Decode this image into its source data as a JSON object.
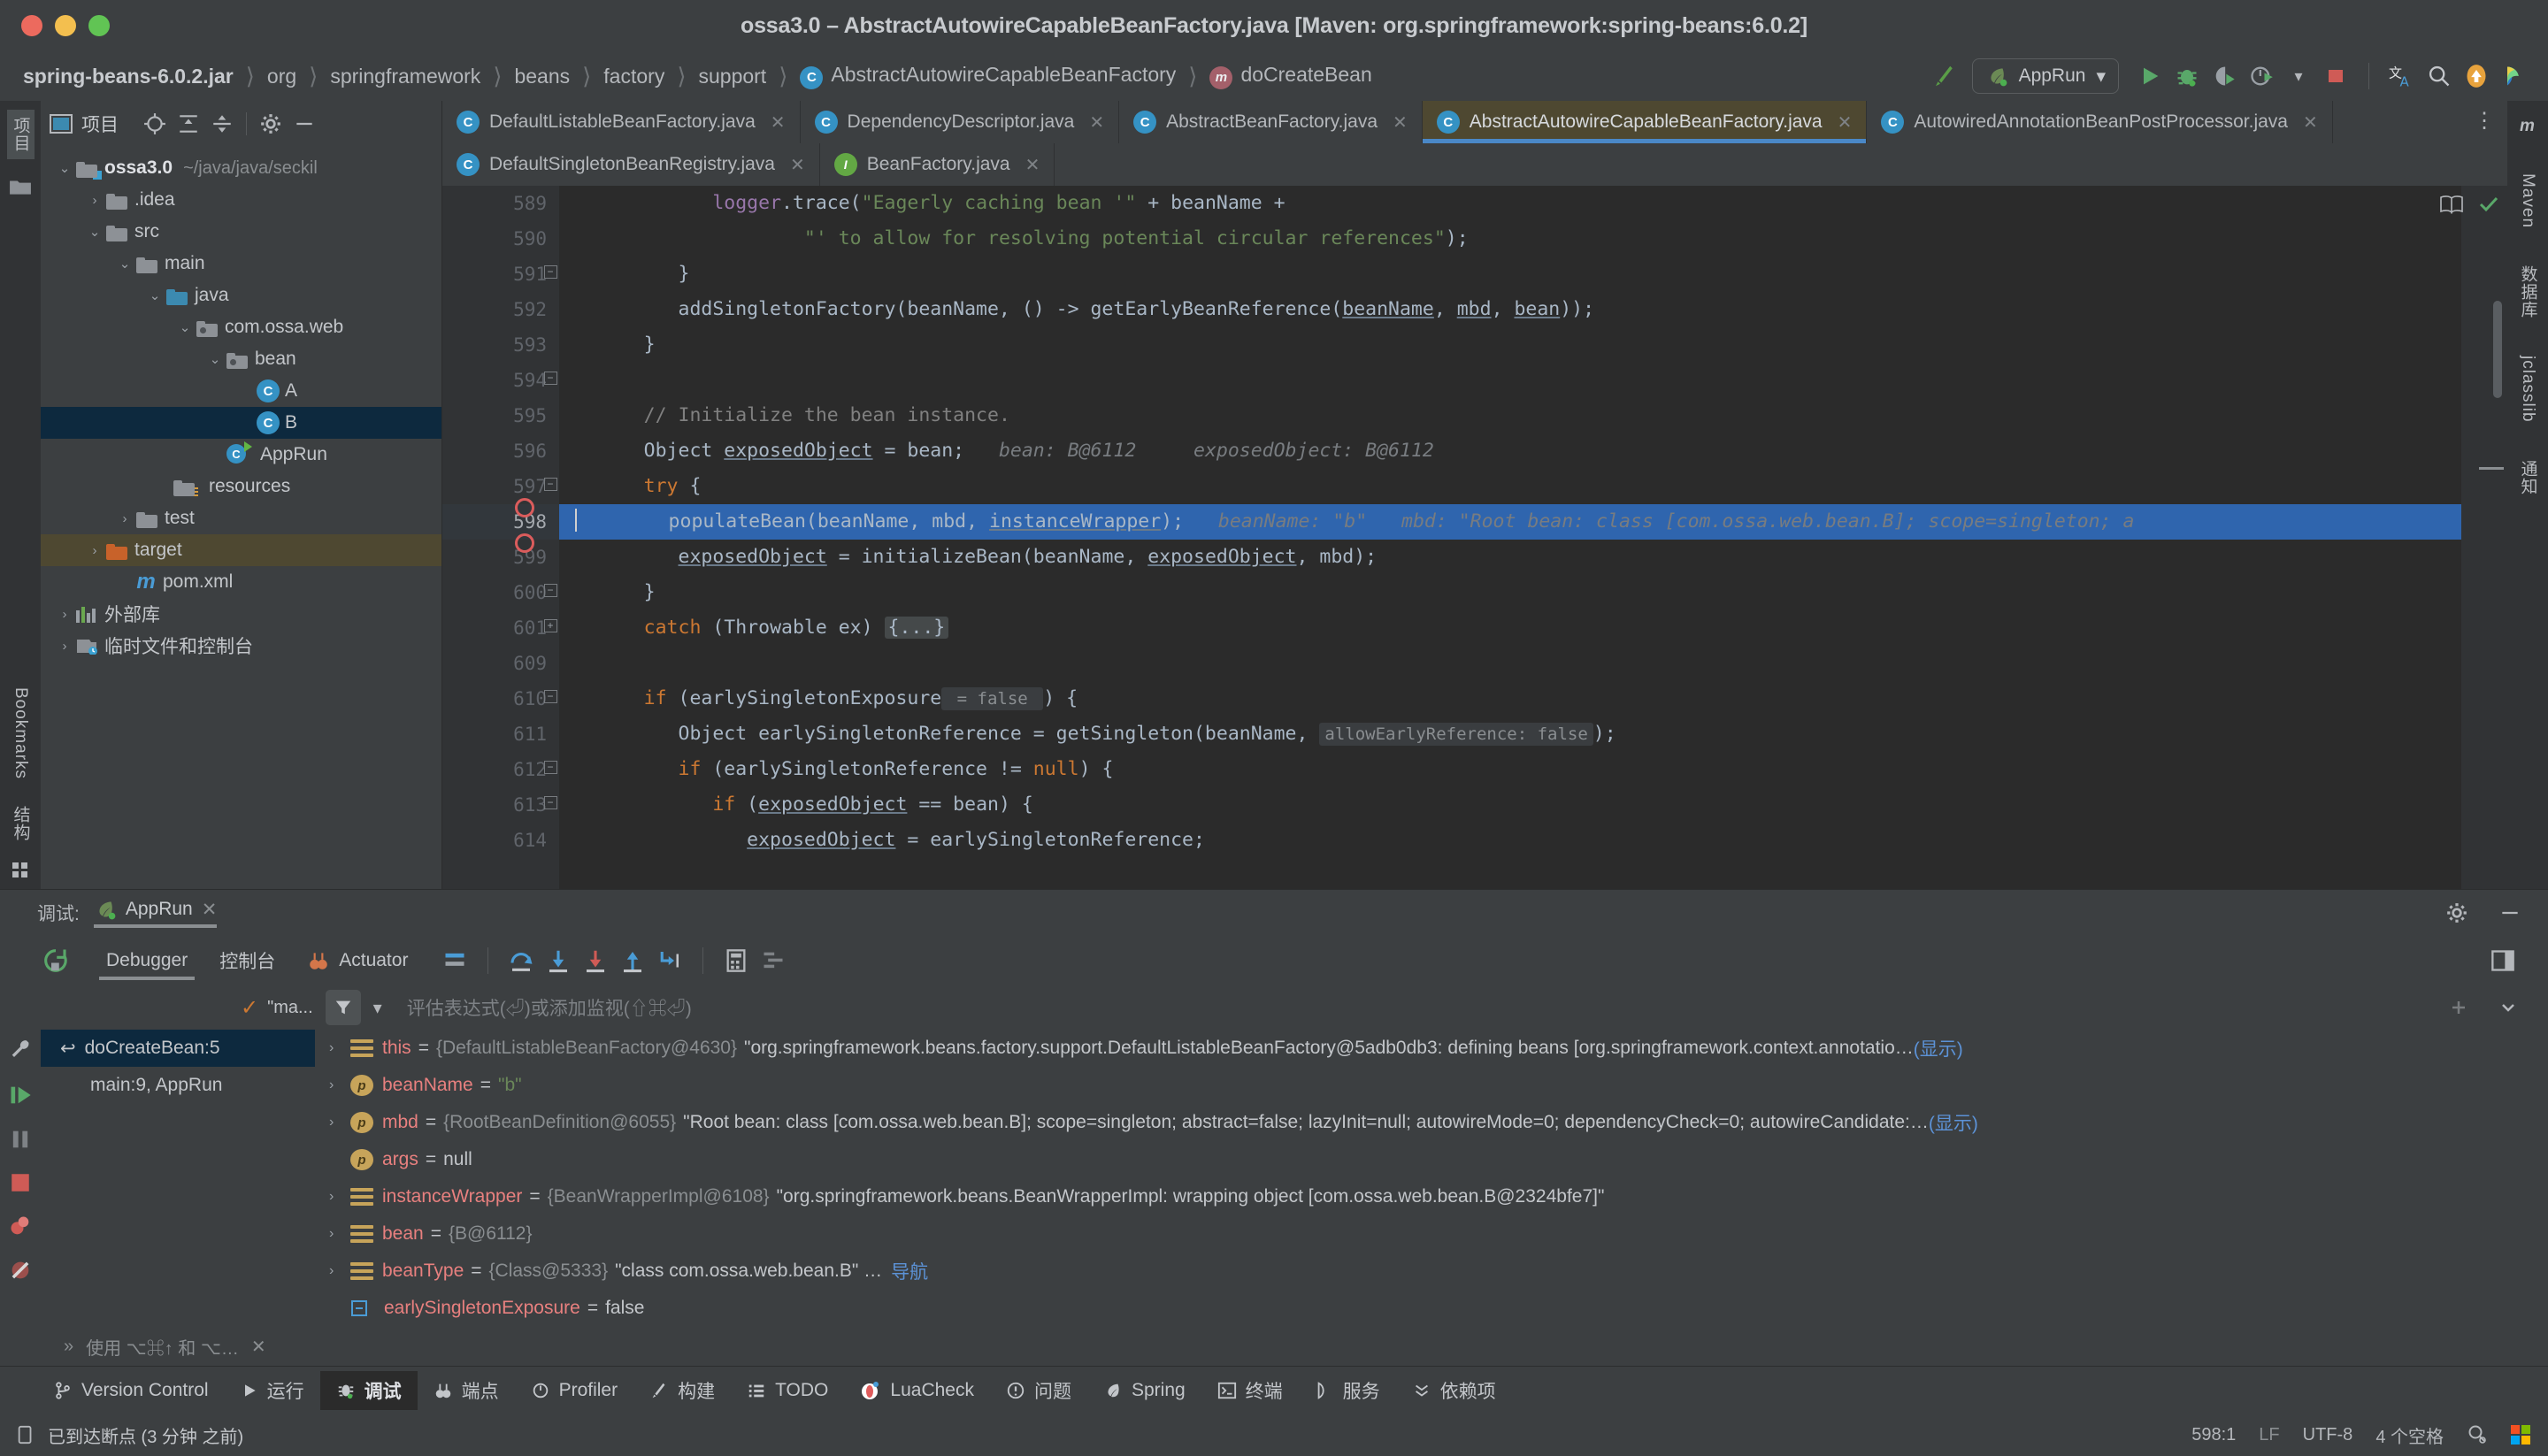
{
  "window": {
    "title": "ossa3.0 – AbstractAutowireCapableBeanFactory.java [Maven: org.springframework:spring-beans:6.0.2]"
  },
  "breadcrumb": {
    "items": [
      {
        "label": "spring-beans-6.0.2.jar",
        "bold": true,
        "icon": "none"
      },
      {
        "label": "org",
        "bold": false,
        "icon": "none"
      },
      {
        "label": "springframework",
        "bold": false,
        "icon": "none"
      },
      {
        "label": "beans",
        "bold": false,
        "icon": "none"
      },
      {
        "label": "factory",
        "bold": false,
        "icon": "none"
      },
      {
        "label": "support",
        "bold": false,
        "icon": "none"
      },
      {
        "label": "AbstractAutowireCapableBeanFactory",
        "bold": false,
        "icon": "class-badge"
      },
      {
        "label": "doCreateBean",
        "bold": false,
        "icon": "method-badge"
      }
    ]
  },
  "toolbar": {
    "build_icon": "hammer-icon",
    "run_config": {
      "label": "AppRun",
      "icon": "spring-leaf-icon",
      "chevron": "▾"
    },
    "actions": [
      {
        "name": "run-button",
        "icon": "play-icon"
      },
      {
        "name": "debug-button",
        "icon": "bug-icon"
      },
      {
        "name": "run-with-coverage-button",
        "icon": "coverage-icon"
      },
      {
        "name": "profiler-button",
        "icon": "profiler-icon"
      },
      {
        "name": "profiler-dropdown",
        "icon": "chevron-down-icon"
      },
      {
        "name": "stop-button",
        "icon": "stop-icon"
      }
    ],
    "right_actions": [
      {
        "name": "translate-button",
        "icon": "translate-icon"
      },
      {
        "name": "search-everywhere-button",
        "icon": "search-icon"
      },
      {
        "name": "update-button",
        "icon": "arrow-up-circle-icon"
      },
      {
        "name": "ai-assistant-button",
        "icon": "ai-icon"
      }
    ]
  },
  "left_strip": {
    "tabs": [
      {
        "label": "项目",
        "selected": true
      },
      {
        "label": "",
        "icon": "folder-icon",
        "selected": false
      }
    ],
    "bottom_tabs": [
      {
        "label": "Bookmarks"
      },
      {
        "label": "结构"
      }
    ]
  },
  "right_strip": {
    "tabs": [
      "m",
      "数据库",
      "jclasslib",
      "通知"
    ]
  },
  "project_panel": {
    "title": "项目",
    "header_icons": [
      {
        "name": "select-opened-file-icon"
      },
      {
        "name": "expand-all-icon"
      },
      {
        "name": "collapse-all-icon"
      },
      {
        "name": "settings-gear-icon"
      },
      {
        "name": "hide-panel-icon"
      }
    ],
    "tree": [
      {
        "label": "ossa3.0",
        "suffix": "~/java/java/seckil",
        "depth": 0,
        "arrow": "down",
        "icon": "module-folder",
        "bold": true,
        "selected": "none"
      },
      {
        "label": ".idea",
        "depth": 1,
        "arrow": "right",
        "icon": "folder",
        "selected": "none"
      },
      {
        "label": "src",
        "depth": 1,
        "arrow": "down",
        "icon": "folder",
        "selected": "none"
      },
      {
        "label": "main",
        "depth": 2,
        "arrow": "down",
        "icon": "folder",
        "selected": "none"
      },
      {
        "label": "java",
        "depth": 3,
        "arrow": "down",
        "icon": "source-folder",
        "selected": "none"
      },
      {
        "label": "com.ossa.web",
        "depth": 4,
        "arrow": "down",
        "icon": "package",
        "selected": "none"
      },
      {
        "label": "bean",
        "depth": 5,
        "arrow": "down",
        "icon": "package",
        "selected": "none"
      },
      {
        "label": "A",
        "depth": 6,
        "arrow": "none",
        "icon": "class",
        "selected": "none"
      },
      {
        "label": "B",
        "depth": 6,
        "arrow": "none",
        "icon": "class",
        "selected": "blue"
      },
      {
        "label": "AppRun",
        "depth": 5,
        "arrow": "none",
        "icon": "runnable-class",
        "selected": "none"
      },
      {
        "label": "resources",
        "depth": 3,
        "arrow": "none",
        "icon": "resource-folder",
        "selected": "none"
      },
      {
        "label": "test",
        "depth": 2,
        "arrow": "right",
        "icon": "folder",
        "selected": "none"
      },
      {
        "label": "target",
        "depth": 1,
        "arrow": "right",
        "icon": "excluded-folder",
        "selected": "brown"
      },
      {
        "label": "pom.xml",
        "depth": 1,
        "arrow": "none",
        "icon": "maven",
        "selected": "none"
      },
      {
        "label": "外部库",
        "depth": 0,
        "arrow": "right",
        "icon": "library",
        "selected": "none"
      },
      {
        "label": "临时文件和控制台",
        "depth": 0,
        "arrow": "right",
        "icon": "scratches",
        "selected": "none"
      }
    ]
  },
  "editor_tabs": {
    "row1": [
      {
        "label": "DefaultListableBeanFactory.java",
        "icon": "class",
        "active": false
      },
      {
        "label": "DependencyDescriptor.java",
        "icon": "class",
        "active": false
      },
      {
        "label": "AbstractBeanFactory.java",
        "icon": "abstract-class",
        "active": false
      },
      {
        "label": "AbstractAutowireCapableBeanFactory.java",
        "icon": "abstract-class",
        "active": true
      },
      {
        "label": "AutowiredAnnotationBeanPostProcessor.java",
        "icon": "class",
        "active": false
      }
    ],
    "row2": [
      {
        "label": "DefaultSingletonBeanRegistry.java",
        "icon": "class",
        "active": false
      },
      {
        "label": "BeanFactory.java",
        "icon": "interface",
        "active": false
      }
    ],
    "close_label": "✕",
    "more_label": "⋮"
  },
  "code": {
    "lines": [
      {
        "n": "589",
        "indent": 0,
        "breakpoint": false,
        "fold": "none",
        "highlight": "none",
        "segments": [
          {
            "t": "            ",
            "c": ""
          },
          {
            "t": "logger",
            "c": "fld"
          },
          {
            "t": ".trace(",
            "c": ""
          },
          {
            "t": "\"Eagerly caching bean '\"",
            "c": "str"
          },
          {
            "t": " + beanName +",
            "c": ""
          }
        ]
      },
      {
        "n": "590",
        "indent": 0,
        "breakpoint": false,
        "fold": "none",
        "highlight": "none",
        "segments": [
          {
            "t": "                    ",
            "c": ""
          },
          {
            "t": "\"' to allow for resolving potential circular references\"",
            "c": "str"
          },
          {
            "t": ");",
            "c": ""
          }
        ]
      },
      {
        "n": "591",
        "indent": 0,
        "breakpoint": false,
        "fold": "minus",
        "highlight": "none",
        "segments": [
          {
            "t": "         }",
            "c": ""
          }
        ]
      },
      {
        "n": "592",
        "indent": 0,
        "breakpoint": false,
        "fold": "none",
        "highlight": "none",
        "segments": [
          {
            "t": "         addSingletonFactory(beanName, () -> getEarlyBeanReference(",
            "c": ""
          },
          {
            "t": "beanName",
            "c": "ul"
          },
          {
            "t": ", ",
            "c": ""
          },
          {
            "t": "mbd",
            "c": "ul"
          },
          {
            "t": ", ",
            "c": ""
          },
          {
            "t": "bean",
            "c": "ul"
          },
          {
            "t": "));",
            "c": ""
          }
        ]
      },
      {
        "n": "593",
        "indent": 0,
        "breakpoint": false,
        "fold": "minus",
        "highlight": "none",
        "segments": [
          {
            "t": "      }",
            "c": ""
          }
        ]
      },
      {
        "n": "594",
        "indent": 0,
        "breakpoint": false,
        "fold": "none",
        "highlight": "none",
        "segments": [
          {
            "t": "",
            "c": ""
          }
        ]
      },
      {
        "n": "595",
        "indent": 0,
        "breakpoint": false,
        "fold": "none",
        "highlight": "none",
        "segments": [
          {
            "t": "      // Initialize the bean instance.",
            "c": "cmt"
          }
        ]
      },
      {
        "n": "596",
        "indent": 0,
        "breakpoint": false,
        "fold": "none",
        "highlight": "none",
        "segments": [
          {
            "t": "      Object ",
            "c": ""
          },
          {
            "t": "exposedObject",
            "c": "ul"
          },
          {
            "t": " = bean;",
            "c": ""
          },
          {
            "t": "   bean: B@6112     exposedObject: B@6112",
            "c": "hint"
          }
        ]
      },
      {
        "n": "597",
        "indent": 0,
        "breakpoint": false,
        "fold": "minus",
        "highlight": "none",
        "segments": [
          {
            "t": "      ",
            "c": ""
          },
          {
            "t": "try",
            "c": "kw"
          },
          {
            "t": " {",
            "c": ""
          }
        ]
      },
      {
        "n": "598",
        "indent": 0,
        "breakpoint": true,
        "fold": "none",
        "highlight": "current",
        "segments": [
          {
            "t": "         populateBean(beanName, mbd, ",
            "c": ""
          },
          {
            "t": "instanceWrapper",
            "c": "ul"
          },
          {
            "t": ");",
            "c": ""
          },
          {
            "t": "   beanName: \"b\"   mbd: \"Root bean: class [com.ossa.web.bean.B]; scope=singleton; a",
            "c": "hint"
          }
        ]
      },
      {
        "n": "599",
        "indent": 0,
        "breakpoint": true,
        "fold": "none",
        "highlight": "none",
        "segments": [
          {
            "t": "         ",
            "c": ""
          },
          {
            "t": "exposedObject",
            "c": "ul"
          },
          {
            "t": " = initializeBean(beanName, ",
            "c": ""
          },
          {
            "t": "exposedObject",
            "c": "ul"
          },
          {
            "t": ", mbd);",
            "c": ""
          }
        ]
      },
      {
        "n": "600",
        "indent": 0,
        "breakpoint": false,
        "fold": "minus",
        "highlight": "none",
        "segments": [
          {
            "t": "      }",
            "c": ""
          }
        ]
      },
      {
        "n": "601",
        "indent": 0,
        "breakpoint": false,
        "fold": "plus",
        "highlight": "none",
        "segments": [
          {
            "t": "      ",
            "c": ""
          },
          {
            "t": "catch",
            "c": "kw"
          },
          {
            "t": " (Throwable ex) ",
            "c": ""
          },
          {
            "t": "{...}",
            "c": "foldph"
          }
        ]
      },
      {
        "n": "609",
        "indent": 0,
        "breakpoint": false,
        "fold": "none",
        "highlight": "none",
        "segments": [
          {
            "t": "",
            "c": ""
          }
        ]
      },
      {
        "n": "610",
        "indent": 0,
        "breakpoint": false,
        "fold": "minus",
        "highlight": "none",
        "segments": [
          {
            "t": "      ",
            "c": ""
          },
          {
            "t": "if",
            "c": "kw"
          },
          {
            "t": " (earlySingletonExposure",
            "c": ""
          },
          {
            "t": " = false ",
            "c": "hintbox"
          },
          {
            "t": ") {",
            "c": ""
          }
        ]
      },
      {
        "n": "611",
        "indent": 0,
        "breakpoint": false,
        "fold": "none",
        "highlight": "none",
        "segments": [
          {
            "t": "         Object earlySingletonReference = getSingleton(beanName, ",
            "c": ""
          },
          {
            "t": "allowEarlyReference: false",
            "c": "hintbox"
          },
          {
            "t": ");",
            "c": ""
          }
        ]
      },
      {
        "n": "612",
        "indent": 0,
        "breakpoint": false,
        "fold": "minus",
        "highlight": "none",
        "segments": [
          {
            "t": "         ",
            "c": ""
          },
          {
            "t": "if",
            "c": "kw"
          },
          {
            "t": " (earlySingletonReference != ",
            "c": ""
          },
          {
            "t": "null",
            "c": "kw"
          },
          {
            "t": ") {",
            "c": ""
          }
        ]
      },
      {
        "n": "613",
        "indent": 0,
        "breakpoint": false,
        "fold": "minus",
        "highlight": "none",
        "segments": [
          {
            "t": "            ",
            "c": ""
          },
          {
            "t": "if",
            "c": "kw"
          },
          {
            "t": " (",
            "c": ""
          },
          {
            "t": "exposedObject",
            "c": "ul"
          },
          {
            "t": " == bean) {",
            "c": ""
          }
        ]
      },
      {
        "n": "614",
        "indent": 0,
        "breakpoint": false,
        "fold": "none",
        "highlight": "none",
        "segments": [
          {
            "t": "               ",
            "c": ""
          },
          {
            "t": "exposedObject",
            "c": "ul"
          },
          {
            "t": " = earlySingletonReference;",
            "c": ""
          }
        ]
      }
    ]
  },
  "debug": {
    "header_label": "调试:",
    "session_tab": "AppRun",
    "session_close": "✕",
    "tabs": [
      {
        "label": "Debugger",
        "active": true,
        "icon": "none"
      },
      {
        "label": "控制台",
        "active": false,
        "icon": "none"
      },
      {
        "label": "Actuator",
        "active": false,
        "icon": "actuator-icon"
      }
    ],
    "step_actions": [
      {
        "name": "show-execution-point-button",
        "icon": "layout-icon"
      },
      {
        "name": "step-over-button",
        "icon": "step-over-icon"
      },
      {
        "name": "step-into-button",
        "icon": "step-into-icon"
      },
      {
        "name": "force-step-into-button",
        "icon": "force-step-into-icon"
      },
      {
        "name": "step-out-button",
        "icon": "step-out-icon"
      },
      {
        "name": "run-to-cursor-button",
        "icon": "run-to-cursor-icon"
      },
      {
        "name": "evaluate-expression-button",
        "icon": "calculator-icon"
      },
      {
        "name": "settings-button",
        "icon": "threads-icon"
      }
    ],
    "watch_filter_label": "\"ma...",
    "watch_placeholder": "评估表达式(⏎)或添加监视(⇧⌘⏎)",
    "frames": [
      {
        "label": "doCreateBean:5",
        "selected": true,
        "icon": "frame-icon"
      },
      {
        "label": "main:9, AppRun",
        "selected": false,
        "icon": "none"
      }
    ],
    "variables": [
      {
        "expand": true,
        "icon": "object",
        "name": "this",
        "eq": "=",
        "ref": "{DefaultListableBeanFactory@4630}",
        "value": "\"org.springframework.beans.factory.support.DefaultListableBeanFactory@5adb0db3: defining beans [org.springframework.context.annotatio…",
        "show": "(显示)"
      },
      {
        "expand": true,
        "icon": "param",
        "name": "beanName",
        "eq": "=",
        "ref": "",
        "value": "\"b\"",
        "value_class": "green",
        "show": ""
      },
      {
        "expand": true,
        "icon": "param",
        "name": "mbd",
        "eq": "=",
        "ref": "{RootBeanDefinition@6055}",
        "value": "\"Root bean: class [com.ossa.web.bean.B]; scope=singleton; abstract=false; lazyInit=null; autowireMode=0; dependencyCheck=0; autowireCandidate:…",
        "show": "(显示)"
      },
      {
        "expand": false,
        "icon": "param",
        "name": "args",
        "eq": "=",
        "ref": "",
        "value": "null",
        "show": ""
      },
      {
        "expand": true,
        "icon": "object",
        "name": "instanceWrapper",
        "eq": "=",
        "ref": "{BeanWrapperImpl@6108}",
        "value": "\"org.springframework.beans.BeanWrapperImpl: wrapping object [com.ossa.web.bean.B@2324bfe7]\"",
        "show": ""
      },
      {
        "expand": true,
        "icon": "object",
        "name": "bean",
        "eq": "=",
        "ref": "{B@6112}",
        "value": "",
        "show": ""
      },
      {
        "expand": true,
        "icon": "object",
        "name": "beanType",
        "eq": "=",
        "ref": "{Class@5333}",
        "value": "\"class com.ossa.web.bean.B\" …",
        "link": "导航",
        "show": ""
      },
      {
        "expand": false,
        "icon": "bool",
        "name": "earlySingletonExposure",
        "eq": "=",
        "ref": "",
        "value": "false",
        "show": ""
      }
    ],
    "footer_hint": "使用 ⌥⌘↑ 和 ⌥…",
    "footer_close": "✕"
  },
  "tool_windows": [
    {
      "label": "Version Control",
      "icon": "vcs-icon",
      "active": false
    },
    {
      "label": "运行",
      "icon": "play-icon",
      "active": false
    },
    {
      "label": "调试",
      "icon": "bug-icon",
      "active": true
    },
    {
      "label": "端点",
      "icon": "endpoints-icon",
      "active": false
    },
    {
      "label": "Profiler",
      "icon": "profiler-icon",
      "active": false
    },
    {
      "label": "构建",
      "icon": "hammer-icon",
      "active": false
    },
    {
      "label": "TODO",
      "icon": "todo-icon",
      "active": false
    },
    {
      "label": "LuaCheck",
      "icon": "luacheck-icon",
      "active": false
    },
    {
      "label": "问题",
      "icon": "problems-icon",
      "active": false
    },
    {
      "label": "Spring",
      "icon": "spring-leaf-icon",
      "active": false
    },
    {
      "label": "终端",
      "icon": "terminal-icon",
      "active": false
    },
    {
      "label": "服务",
      "icon": "services-icon",
      "active": false
    },
    {
      "label": "依赖项",
      "icon": "dependencies-icon",
      "active": false
    }
  ],
  "status_bar": {
    "message": "已到达断点 (3 分钟 之前)",
    "message_icon": "notification-icon",
    "caret": "598:1",
    "line_separator": "LF",
    "encoding": "UTF-8",
    "indent": "4 个空格",
    "inspection_icon": "inspection-icon",
    "os_icon": "windows-logo-icon"
  }
}
